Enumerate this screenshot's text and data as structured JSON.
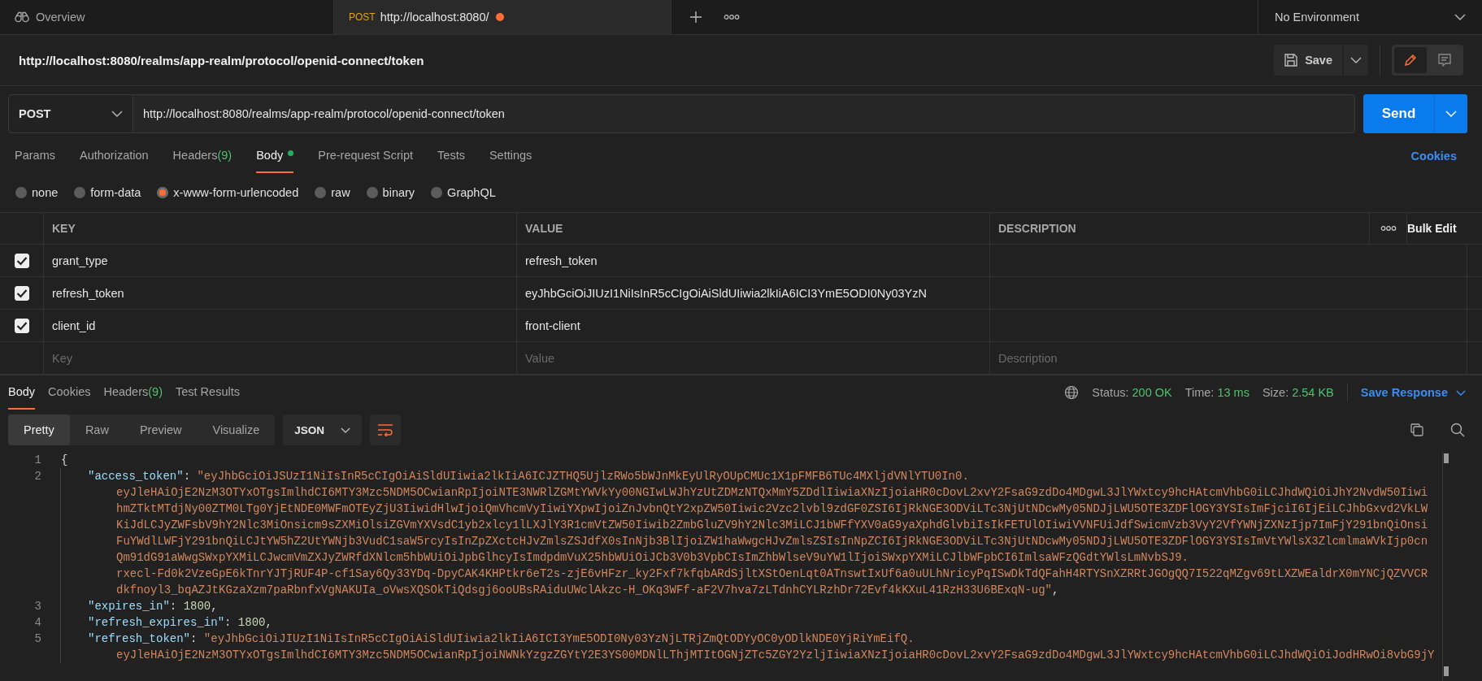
{
  "tabs": [
    {
      "kind": "overview",
      "label": "Overview",
      "selected": false
    },
    {
      "kind": "request",
      "method": "POST",
      "label": "http://localhost:8080/",
      "selected": true,
      "unsaved": true
    }
  ],
  "environment": "No Environment",
  "request_title": "http://localhost:8080/realms/app-realm/protocol/openid-connect/token",
  "save_label": "Save",
  "method": "POST",
  "url": "http://localhost:8080/realms/app-realm/protocol/openid-connect/token",
  "send_label": "Send",
  "request_tabs": [
    {
      "label": "Params",
      "selected": false,
      "dot": false
    },
    {
      "label": "Authorization",
      "selected": false,
      "dot": false
    },
    {
      "label": "Headers",
      "count": "(9)",
      "selected": false,
      "dot": false
    },
    {
      "label": "Body",
      "selected": true,
      "dot": true
    },
    {
      "label": "Pre-request Script",
      "selected": false,
      "dot": false
    },
    {
      "label": "Tests",
      "selected": false,
      "dot": false
    },
    {
      "label": "Settings",
      "selected": false,
      "dot": false
    }
  ],
  "cookies_link": "Cookies",
  "body_types": [
    {
      "label": "none",
      "selected": false
    },
    {
      "label": "form-data",
      "selected": false
    },
    {
      "label": "x-www-form-urlencoded",
      "selected": true
    },
    {
      "label": "raw",
      "selected": false
    },
    {
      "label": "binary",
      "selected": false
    },
    {
      "label": "GraphQL",
      "selected": false
    }
  ],
  "params_table": {
    "columns": [
      "KEY",
      "VALUE",
      "DESCRIPTION"
    ],
    "bulk_edit": "Bulk Edit",
    "rows": [
      {
        "checked": true,
        "key": "grant_type",
        "value": "refresh_token"
      },
      {
        "checked": true,
        "key": "refresh_token",
        "value": "eyJhbGciOiJIUzI1NiIsInR5cCIgOiAiSldUIiwia2lkIiA6ICI3YmE5ODI0Ny03YzN"
      },
      {
        "checked": true,
        "key": "client_id",
        "value": "front-client"
      }
    ],
    "new_row": {
      "key_placeholder": "Key",
      "value_placeholder": "Value",
      "description_placeholder": "Description"
    }
  },
  "response_tabs": [
    {
      "label": "Body",
      "selected": true
    },
    {
      "label": "Cookies",
      "selected": false
    },
    {
      "label": "Headers",
      "count": "(9)",
      "selected": false
    },
    {
      "label": "Test Results",
      "selected": false
    }
  ],
  "status": {
    "status_label": "Status:",
    "status": "200 OK",
    "time_label": "Time:",
    "time": "13 ms",
    "size_label": "Size:",
    "size": "2.54 KB"
  },
  "save_response": "Save Response",
  "view_modes": [
    {
      "label": "Pretty",
      "selected": true
    },
    {
      "label": "Raw",
      "selected": false
    },
    {
      "label": "Preview",
      "selected": false
    },
    {
      "label": "Visualize",
      "selected": false
    }
  ],
  "format": "JSON",
  "code_lines": [
    {
      "kind": "open",
      "number": "1",
      "tokens": [
        {
          "kind": "punct",
          "text": "{"
        }
      ]
    },
    {
      "kind": "entry",
      "number": "2",
      "tokens": [
        {
          "kind": "key",
          "text": "\"access_token\""
        },
        {
          "kind": "punct",
          "text": ": "
        },
        {
          "kind": "string",
          "text": "\"eyJhbGciOiJSUzI1NiIsInR5cCIgOiAiSldUIiwia2lkIiA6ICJZTHQ5UjlzRWo5bWJnMkEyUlRyOUpCMUc1X1pFMFB6TUc4MXljdVNlYTU0In0."
        }
      ]
    },
    {
      "kind": "continuation",
      "tokens": [
        {
          "kind": "string",
          "text": "eyJleHAiOjE2NzM3OTYxOTgsImlhdCI6MTY3Mzc5NDM5OCwianRpIjoiNTE3NWRlZGMtYWVkYy00NGIwLWJhYzUtZDMzNTQxMmY5ZDdlIiwiaXNzIjoiaHR0cDovL2xvY2FsaG9zdDo4MDgwL3JlYWxtcy9hcHAtcmVhbG0iLCJhdWQiOiJhY2NvdW50Iiwi"
        }
      ]
    },
    {
      "kind": "continuation",
      "tokens": [
        {
          "kind": "string",
          "text": "hmZTktMTdjNy00ZTM0LTg0YjEtNDE0MWFmOTEyZjU3IiwidHlwIjoiQmVhcmVyIiwiYXpwIjoiZnJvbnQtY2xpZW50Iiwic2Vzc2lvbl9zdGF0ZSI6IjRkNGE3ODViLTc3NjUtNDcwMy05NDJjLWU5OTE3ZDFlOGY3YSIsImFjciI6IjEiLCJhbGxvd2VkLW"
        }
      ]
    },
    {
      "kind": "continuation",
      "tokens": [
        {
          "kind": "string",
          "text": "KiJdLCJyZWFsbV9hY2Nlc3MiOnsicm9sZXMiOlsiZGVmYXVsdC1yb2xlcy1lLXJlY3R1cmVtZW50Iiwib2ZmbGluZV9hY2Nlc3MiLCJ1bWFfYXV0aG9yaXphdGlvbiIsIkFETUlOIiwiVVNFUiJdfSwicmVzb3VyY2VfYWNjZXNzIjp7ImFjY291bnQiOnsi"
        }
      ]
    },
    {
      "kind": "continuation",
      "tokens": [
        {
          "kind": "string",
          "text": "FuYWdlLWFjY291bnQiLCJtYW5hZ2UtYWNjb3VudC1saW5rcyIsInZpZXctcHJvZmlsZSJdfX0sInNjb3BlIjoiZW1haWwgcHJvZmlsZSIsInNpZCI6IjRkNGE3ODViLTc3NjUtNDcwMy05NDJjLWU5OTE3ZDFlOGY3YSIsImVtYWlsX3ZlcmlmaWVkIjp0cn"
        }
      ]
    },
    {
      "kind": "continuation",
      "tokens": [
        {
          "kind": "string",
          "text": "Qm91dG91aWwgSWxpYXMiLCJwcmVmZXJyZWRfdXNlcm5hbWUiOiJpbGlhcyIsImdpdmVuX25hbWUiOiJCb3V0b3VpbCIsImZhbWlseV9uYW1lIjoiSWxpYXMiLCJlbWFpbCI6ImlsaWFzQGdtYWlsLmNvbSJ9."
        }
      ]
    },
    {
      "kind": "continuation",
      "tokens": [
        {
          "kind": "string",
          "text": "rxecl-Fd0k2VzeGpE6kTnrYJTjRUF4P-cf1Say6Qy33YDq-DpyCAK4KHPtkr6eT2s-zjE6vHFzr_ky2Fxf7kfqbARdSjltXStOenLqt0ATnswtIxUf6a0uULhNricyPqISwDkTdQFahH4RTYSnXZRRtJGOgQQ7I522qMZgv69tLXZWEaldrX0mYNCjQZVVCR"
        }
      ]
    },
    {
      "kind": "continuation",
      "tokens": [
        {
          "kind": "string",
          "text": "dkfnoyl3_bqAZJtKGzaXzm7paRbnfxVgNAKUIa_oVwsXQSOkTiQdsgj6ooUBsRAiduUWclAkzc-H_OKq3WFf-aF2V7hva7zLTdnhCYLRzhDr72Evf4kKXuL41RzH33U6BExqN-ug\""
        },
        {
          "kind": "punct",
          "text": ","
        }
      ]
    },
    {
      "kind": "entry",
      "number": "3",
      "tokens": [
        {
          "kind": "key",
          "text": "\"expires_in\""
        },
        {
          "kind": "punct",
          "text": ": "
        },
        {
          "kind": "number",
          "text": "1800"
        },
        {
          "kind": "punct",
          "text": ","
        }
      ]
    },
    {
      "kind": "entry",
      "number": "4",
      "tokens": [
        {
          "kind": "key",
          "text": "\"refresh_expires_in\""
        },
        {
          "kind": "punct",
          "text": ": "
        },
        {
          "kind": "number",
          "text": "1800"
        },
        {
          "kind": "punct",
          "text": ","
        }
      ]
    },
    {
      "kind": "entry",
      "number": "5",
      "tokens": [
        {
          "kind": "key",
          "text": "\"refresh_token\""
        },
        {
          "kind": "punct",
          "text": ": "
        },
        {
          "kind": "string",
          "text": "\"eyJhbGciOiJIUzI1NiIsInR5cCIgOiAiSldUIiwia2lkIiA6ICI3YmE5ODI0Ny03YzNjLTRjZmQtODYyOC0yODlkNDE0YjRiYmEifQ."
        }
      ]
    },
    {
      "kind": "continuation",
      "tokens": [
        {
          "kind": "string",
          "text": "eyJleHAiOjE2NzM3OTYxOTgsImlhdCI6MTY3Mzc5NDM5OCwianRpIjoiNWNkYzgzZGYtY2E3YS00MDNlLThjMTItOGNjZTc5ZGY2YzljIiwiaXNzIjoiaHR0cDovL2xvY2FsaG9zdDo4MDgwL3JlYWxtcy9hcHAtcmVhbG0iLCJhdWQiOiJodHRwOi8vbG9jY"
        }
      ]
    }
  ]
}
